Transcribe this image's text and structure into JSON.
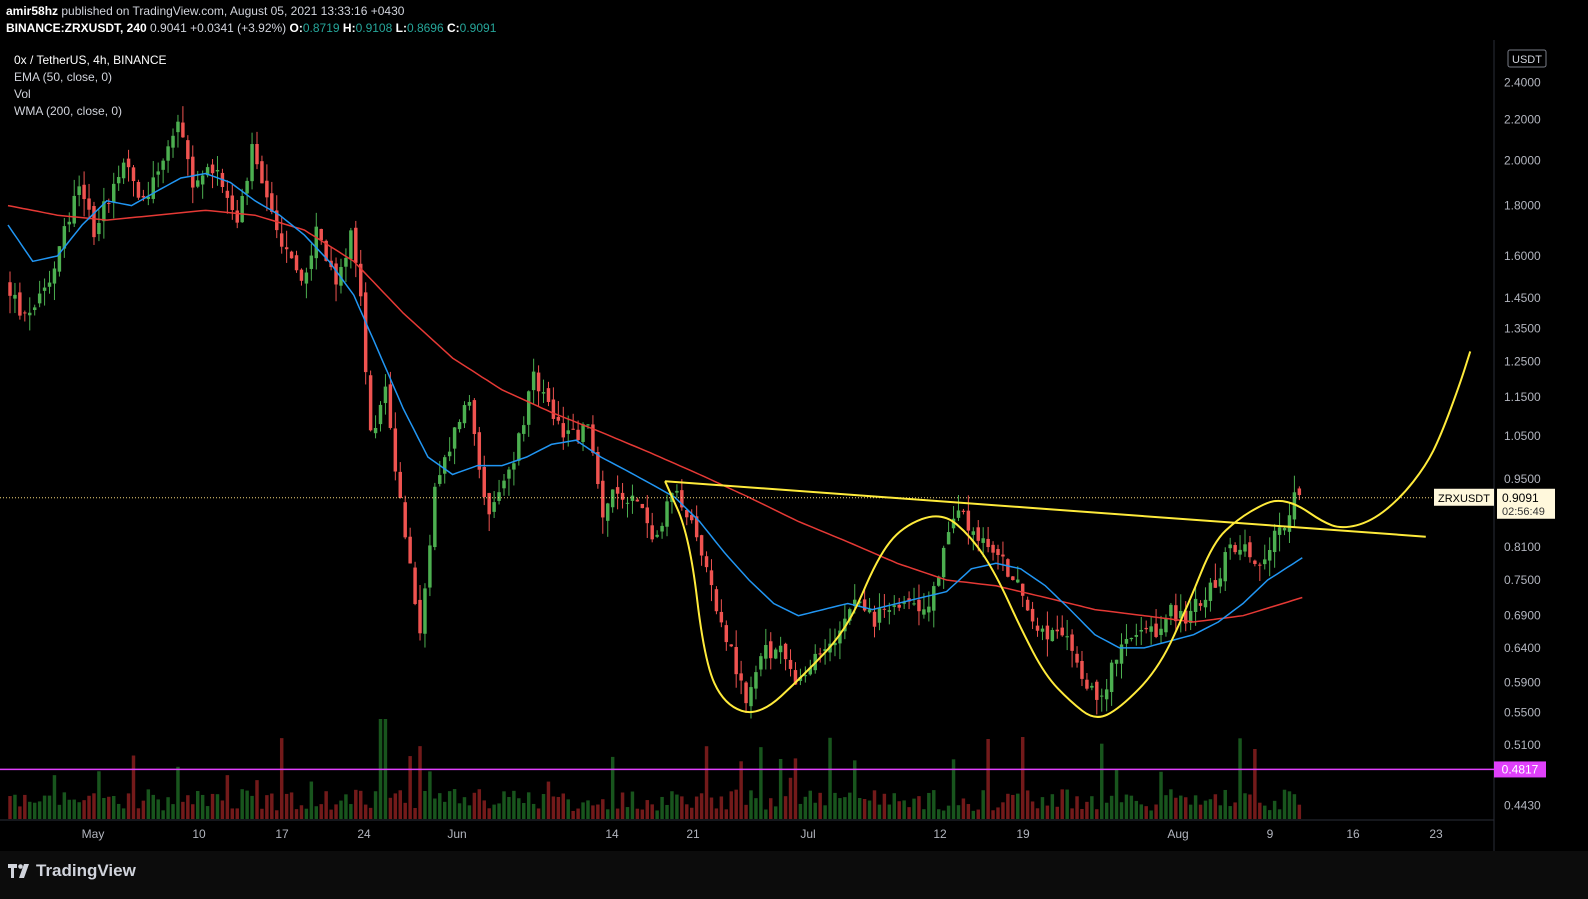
{
  "header": {
    "author": "amir58hz",
    "published_text": "published on TradingView.com, August 05, 2021 13:33:16 +0430",
    "symbol_full": "BINANCE:ZRXUSDT, 240",
    "last": "0.9041",
    "change": "+0.0341 (+3.92%)",
    "o_label": "O:",
    "o": "0.8719",
    "h_label": "H:",
    "h": "0.9108",
    "l_label": "L:",
    "l": "0.8696",
    "c_label": "C:",
    "c": "0.9091"
  },
  "legend": {
    "title": "0x / TetherUS, 4h, BINANCE",
    "ema": "EMA (50, close, 0)",
    "vol": "Vol",
    "wma": "WMA (200, close, 0)"
  },
  "footer": {
    "brand": "TradingView",
    "brand_icon": "tradingview-logo-icon"
  },
  "colors": {
    "up": "#4caf50",
    "down": "#ef5350",
    "ema": "#2196f3",
    "wma": "#e53935",
    "drawing": "#ffeb3b",
    "support": "#e040fb",
    "background": "#000000"
  },
  "chart_data": {
    "type": "candlestick",
    "symbol": "ZRXUSDT",
    "currency_badge": "USDT",
    "scale": "log",
    "x_ticks": [
      "May",
      "10",
      "17",
      "24",
      "Jun",
      "14",
      "21",
      "Jul",
      "12",
      "19",
      "Aug",
      "9",
      "16",
      "23"
    ],
    "y_ticks": [
      "2.4000",
      "2.2000",
      "2.0000",
      "1.8000",
      "1.6000",
      "1.4500",
      "1.3500",
      "1.2500",
      "1.1500",
      "1.0500",
      "0.9500",
      "0.8100",
      "0.7500",
      "0.6900",
      "0.6400",
      "0.5900",
      "0.5500",
      "0.5100",
      "0.4430"
    ],
    "price_label": {
      "symbol": "ZRXUSDT",
      "price": "0.9091",
      "countdown": "02:56:49"
    },
    "support_level": {
      "price": "0.4817"
    },
    "series_path": [
      [
        0,
        1.5
      ],
      [
        4,
        1.38
      ],
      [
        10,
        1.56
      ],
      [
        15,
        1.92
      ],
      [
        18,
        1.7
      ],
      [
        24,
        2.0
      ],
      [
        28,
        1.82
      ],
      [
        35,
        2.18
      ],
      [
        38,
        1.88
      ],
      [
        43,
        1.98
      ],
      [
        47,
        1.72
      ],
      [
        50,
        2.04
      ],
      [
        55,
        1.7
      ],
      [
        60,
        1.5
      ],
      [
        63,
        1.7
      ],
      [
        67,
        1.48
      ],
      [
        70,
        1.7
      ],
      [
        72,
        1.46
      ],
      [
        74,
        1.05
      ],
      [
        77,
        1.18
      ],
      [
        80,
        0.9
      ],
      [
        84,
        0.66
      ],
      [
        87,
        0.92
      ],
      [
        92,
        1.1
      ],
      [
        94,
        1.14
      ],
      [
        98,
        0.86
      ],
      [
        103,
        1.0
      ],
      [
        107,
        1.2
      ],
      [
        110,
        1.12
      ],
      [
        114,
        1.05
      ],
      [
        118,
        1.07
      ],
      [
        121,
        0.88
      ],
      [
        124,
        0.93
      ],
      [
        128,
        0.9
      ],
      [
        132,
        0.82
      ],
      [
        135,
        0.92
      ],
      [
        138,
        0.88
      ],
      [
        142,
        0.76
      ],
      [
        146,
        0.66
      ],
      [
        150,
        0.56
      ],
      [
        153,
        0.63
      ],
      [
        157,
        0.64
      ],
      [
        160,
        0.58
      ],
      [
        164,
        0.62
      ],
      [
        168,
        0.66
      ],
      [
        172,
        0.73
      ],
      [
        176,
        0.68
      ],
      [
        180,
        0.72
      ],
      [
        184,
        0.7
      ],
      [
        187,
        0.71
      ],
      [
        190,
        0.8
      ],
      [
        193,
        0.89
      ],
      [
        196,
        0.84
      ],
      [
        200,
        0.8
      ],
      [
        204,
        0.76
      ],
      [
        208,
        0.68
      ],
      [
        212,
        0.66
      ],
      [
        216,
        0.64
      ],
      [
        219,
        0.58
      ],
      [
        221,
        0.57
      ],
      [
        223,
        0.59
      ],
      [
        226,
        0.64
      ],
      [
        230,
        0.66
      ],
      [
        233,
        0.66
      ],
      [
        236,
        0.7
      ],
      [
        239,
        0.68
      ],
      [
        242,
        0.72
      ],
      [
        245,
        0.74
      ],
      [
        248,
        0.82
      ],
      [
        251,
        0.8
      ],
      [
        254,
        0.78
      ],
      [
        257,
        0.84
      ],
      [
        259,
        0.86
      ],
      [
        261,
        0.9091
      ]
    ],
    "ema_50": [
      [
        0,
        1.72
      ],
      [
        5,
        1.58
      ],
      [
        10,
        1.6
      ],
      [
        15,
        1.72
      ],
      [
        20,
        1.82
      ],
      [
        25,
        1.8
      ],
      [
        30,
        1.86
      ],
      [
        35,
        1.92
      ],
      [
        40,
        1.94
      ],
      [
        45,
        1.9
      ],
      [
        50,
        1.82
      ],
      [
        55,
        1.76
      ],
      [
        60,
        1.68
      ],
      [
        65,
        1.58
      ],
      [
        70,
        1.46
      ],
      [
        75,
        1.28
      ],
      [
        80,
        1.12
      ],
      [
        85,
        1.0
      ],
      [
        90,
        0.96
      ],
      [
        95,
        0.98
      ],
      [
        100,
        0.98
      ],
      [
        105,
        1.0
      ],
      [
        110,
        1.03
      ],
      [
        115,
        1.04
      ],
      [
        120,
        1.0
      ],
      [
        125,
        0.97
      ],
      [
        130,
        0.94
      ],
      [
        135,
        0.91
      ],
      [
        140,
        0.86
      ],
      [
        145,
        0.8
      ],
      [
        150,
        0.75
      ],
      [
        155,
        0.71
      ],
      [
        160,
        0.69
      ],
      [
        165,
        0.7
      ],
      [
        170,
        0.71
      ],
      [
        175,
        0.7
      ],
      [
        180,
        0.71
      ],
      [
        185,
        0.72
      ],
      [
        190,
        0.73
      ],
      [
        195,
        0.77
      ],
      [
        200,
        0.78
      ],
      [
        205,
        0.77
      ],
      [
        210,
        0.74
      ],
      [
        215,
        0.7
      ],
      [
        220,
        0.66
      ],
      [
        225,
        0.64
      ],
      [
        230,
        0.64
      ],
      [
        235,
        0.65
      ],
      [
        240,
        0.66
      ],
      [
        245,
        0.68
      ],
      [
        250,
        0.71
      ],
      [
        255,
        0.75
      ],
      [
        262,
        0.79
      ]
    ],
    "wma_200": [
      [
        0,
        1.8
      ],
      [
        10,
        1.76
      ],
      [
        20,
        1.74
      ],
      [
        30,
        1.76
      ],
      [
        40,
        1.78
      ],
      [
        50,
        1.76
      ],
      [
        60,
        1.7
      ],
      [
        70,
        1.58
      ],
      [
        80,
        1.4
      ],
      [
        90,
        1.26
      ],
      [
        100,
        1.17
      ],
      [
        110,
        1.11
      ],
      [
        120,
        1.06
      ],
      [
        130,
        1.01
      ],
      [
        140,
        0.96
      ],
      [
        150,
        0.91
      ],
      [
        160,
        0.86
      ],
      [
        170,
        0.82
      ],
      [
        180,
        0.78
      ],
      [
        190,
        0.75
      ],
      [
        200,
        0.74
      ],
      [
        210,
        0.72
      ],
      [
        220,
        0.7
      ],
      [
        230,
        0.69
      ],
      [
        240,
        0.68
      ],
      [
        250,
        0.69
      ],
      [
        262,
        0.72
      ]
    ],
    "drawings": {
      "trendline": [
        [
          133,
          0.945
        ],
        [
          287,
          0.83
        ]
      ],
      "pattern_curve": [
        [
          133,
          0.945
        ],
        [
          138,
          0.83
        ],
        [
          141,
          0.62
        ],
        [
          145,
          0.56
        ],
        [
          152,
          0.545
        ],
        [
          161,
          0.6
        ],
        [
          170,
          0.67
        ],
        [
          176,
          0.79
        ],
        [
          181,
          0.85
        ],
        [
          189,
          0.88
        ],
        [
          195,
          0.83
        ],
        [
          200,
          0.76
        ],
        [
          205,
          0.67
        ],
        [
          210,
          0.6
        ],
        [
          215,
          0.565
        ],
        [
          220,
          0.54
        ],
        [
          225,
          0.555
        ],
        [
          233,
          0.61
        ],
        [
          239,
          0.71
        ],
        [
          244,
          0.82
        ],
        [
          249,
          0.865
        ],
        [
          254,
          0.895
        ],
        [
          257,
          0.905
        ],
        [
          261,
          0.895
        ],
        [
          266,
          0.86
        ],
        [
          270,
          0.845
        ],
        [
          276,
          0.86
        ],
        [
          282,
          0.91
        ],
        [
          287,
          0.98
        ],
        [
          290,
          1.05
        ],
        [
          294,
          1.19
        ],
        [
          296,
          1.28
        ]
      ]
    }
  }
}
